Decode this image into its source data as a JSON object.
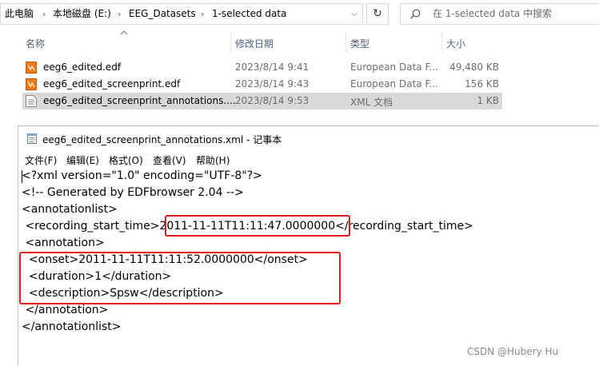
{
  "explorer": {
    "breadcrumb": [
      "此电脑",
      "本地磁盘 (E:)",
      "EEG_Datasets",
      "1-selected data"
    ],
    "search_placeholder": "在 1-selected data 中搜索",
    "columns": {
      "name": "名称",
      "date": "修改日期",
      "type": "类型",
      "size": "大小"
    },
    "files": [
      {
        "name": "eeg6_edited.edf",
        "date": "2023/8/14 9:41",
        "type": "European Data F...",
        "size": "49,480 KB",
        "icon": "edf-file-icon"
      },
      {
        "name": "eeg6_edited_screenprint.edf",
        "date": "2023/8/14 9:43",
        "type": "European Data F...",
        "size": "156 KB",
        "icon": "edf-file-icon"
      },
      {
        "name": "eeg6_edited_screenprint_annotations....",
        "date": "2023/8/14 9:53",
        "type": "XML 文档",
        "size": "1 KB",
        "icon": "xml-file-icon"
      }
    ]
  },
  "notepad": {
    "title": "eeg6_edited_screenprint_annotations.xml - 记事本",
    "menu": [
      "文件(F)",
      "编辑(E)",
      "格式(O)",
      "查看(V)",
      "帮助(H)"
    ],
    "lines": [
      "<?xml version=\"1.0\" encoding=\"UTF-8\"?>",
      "<!-- Generated by EDFbrowser 2.04 -->",
      "<annotationlist>",
      " <recording_start_time>2011-11-11T11:11:47.0000000</recording_start_time>",
      " <annotation>",
      "  <onset>2011-11-11T11:11:52.0000000</onset>",
      "  <duration>1</duration>",
      "  <description>Spsw</description>",
      " </annotation>",
      "</annotationlist>"
    ],
    "highlight_color": "#e0171d"
  },
  "watermark": "CSDN @Hubery Hu"
}
